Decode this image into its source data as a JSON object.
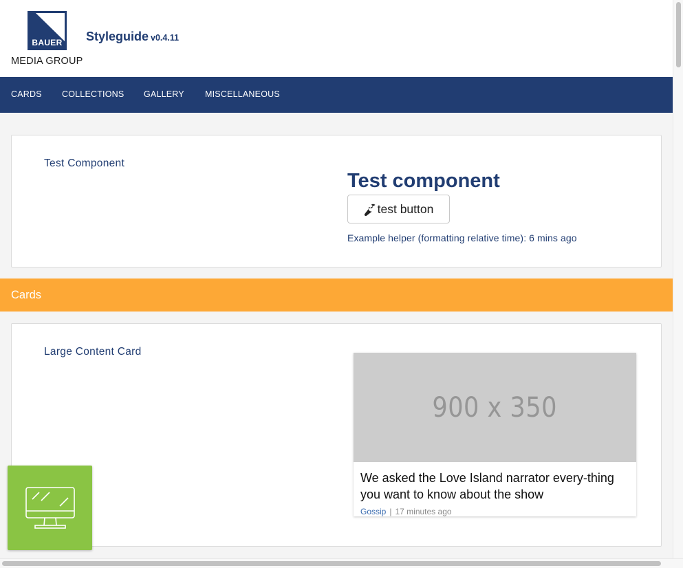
{
  "brand": {
    "logo_word": "BAUER",
    "logo_sub": "MEDIA GROUP",
    "title": "Styleguide",
    "version": "v0.4.11",
    "primary_color": "#213d72",
    "accent_color": "#fda836",
    "widget_color": "#8ac444"
  },
  "nav": {
    "items": [
      {
        "label": "CARDS"
      },
      {
        "label": "COLLECTIONS"
      },
      {
        "label": "GALLERY"
      },
      {
        "label": "MISCELLANEOUS"
      }
    ]
  },
  "test_component": {
    "label": "Test Component",
    "heading": "Test component",
    "button_label": "test button",
    "button_icon": "wrench-icon",
    "helper_text": "Example helper (formatting relative time): 6 mins ago"
  },
  "sections": {
    "cards_title": "Cards"
  },
  "large_content_card": {
    "label": "Large Content Card",
    "image_placeholder": "900 x 350",
    "headline": "We asked the Love Island narrator every-thing you want to know about the show",
    "category": "Gossip",
    "separator": "|",
    "time": "17 minutes ago"
  },
  "widget": {
    "icon": "monitor-icon"
  }
}
